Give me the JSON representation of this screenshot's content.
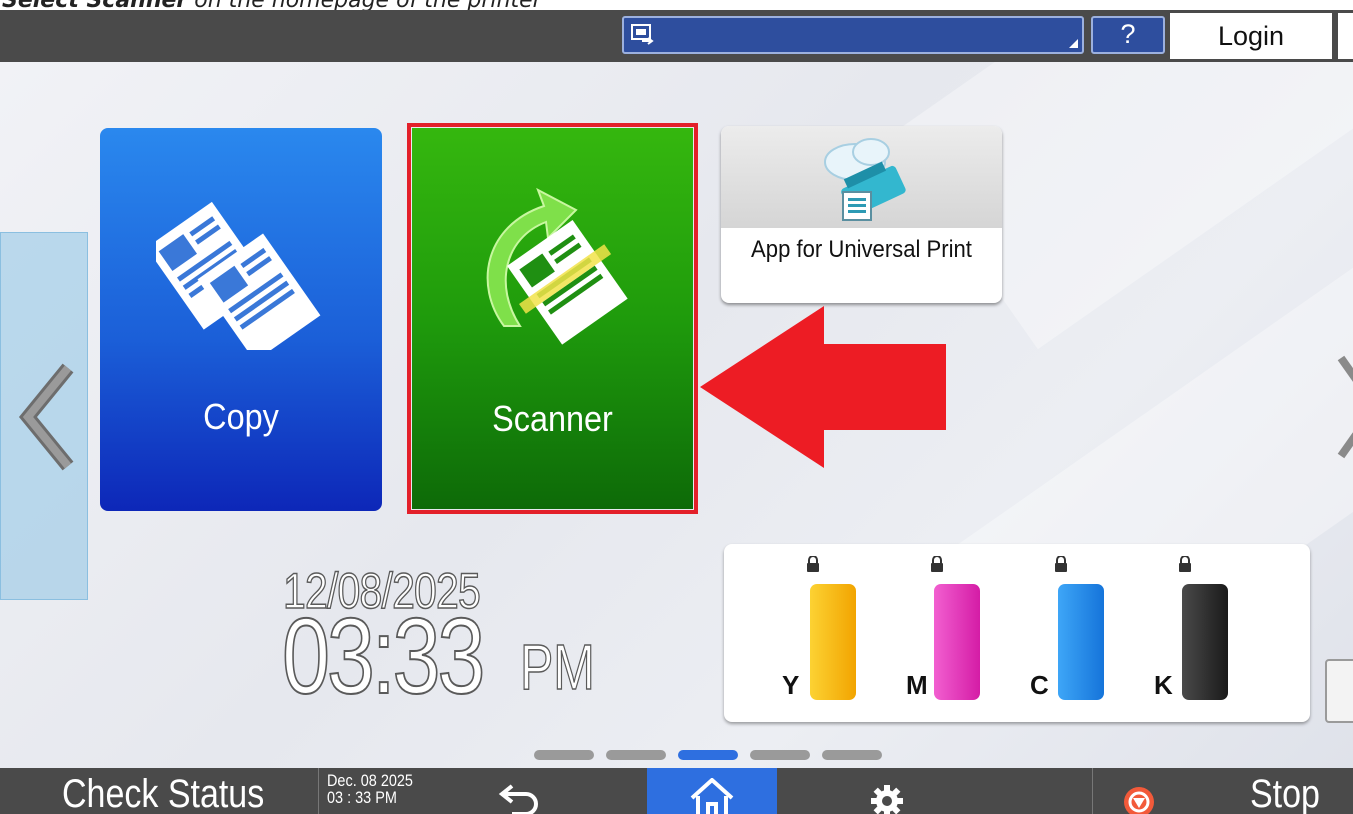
{
  "caption": {
    "bold": "Select Scanner",
    "rest": " on the homepage of the printer"
  },
  "topbar": {
    "help_label": "?",
    "login_label": "Login"
  },
  "tiles": {
    "copy_label": "Copy",
    "scanner_label": "Scanner",
    "app_label": "App for Universal Print"
  },
  "clock": {
    "date": "12/08/2025",
    "time": "03:33",
    "ampm": "PM"
  },
  "toners": [
    {
      "letter": "Y",
      "color": "#f7b50f"
    },
    {
      "letter": "M",
      "color": "#e62fb8"
    },
    {
      "letter": "C",
      "color": "#1e8ff0"
    },
    {
      "letter": "K",
      "color": "#262626"
    }
  ],
  "pager": {
    "count": 5,
    "active_index": 2
  },
  "bottombar": {
    "check_status_label": "Check Status",
    "date_line1": "Dec. 08 2025",
    "date_line2": "03 : 33 PM",
    "stop_label": "Stop"
  },
  "colors": {
    "accent_blue": "#2e6fe0",
    "highlight_red": "#e3202a",
    "scanner_green": "#1f9b0c",
    "copy_blue": "#1b5fd8"
  }
}
